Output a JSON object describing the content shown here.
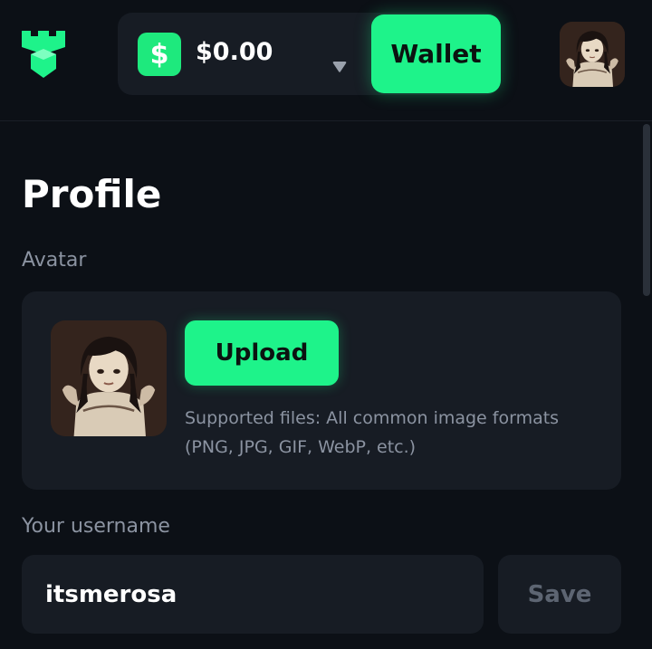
{
  "header": {
    "logo_icon": "castle-tower-icon",
    "currency_icon": "dollar-sign-icon",
    "balance": "$0.00",
    "dropdown_icon": "chevron-down-icon",
    "wallet_label": "Wallet",
    "avatar_icon": "user-avatar-image"
  },
  "profile": {
    "title": "Profile",
    "avatar_label": "Avatar",
    "upload_label": "Upload",
    "supported_files": "Supported files: All common image formats (PNG, JPG, GIF, WebP, etc.)",
    "username_label": "Your username",
    "username_value": "itsmerosa",
    "save_label": "Save"
  },
  "colors": {
    "background": "#0c1016",
    "card": "#171c24",
    "accent": "#1ef38a",
    "muted_text": "#8b93a1"
  }
}
